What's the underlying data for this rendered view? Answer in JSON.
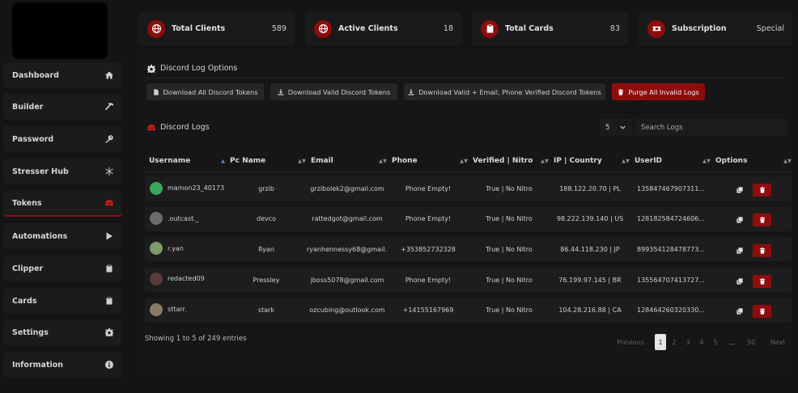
{
  "sidebar": {
    "items": [
      {
        "label": "Dashboard",
        "icon": "home-icon",
        "active": false
      },
      {
        "label": "Builder",
        "icon": "hammer-icon",
        "active": false
      },
      {
        "label": "Password",
        "icon": "key-icon",
        "active": false
      },
      {
        "label": "Stresser Hub",
        "icon": "snowflake-icon",
        "active": false
      },
      {
        "label": "Tokens",
        "icon": "discord-icon",
        "active": true
      },
      {
        "label": "Automations",
        "icon": "play-icon",
        "active": false
      },
      {
        "label": "Clipper",
        "icon": "clipboard-icon",
        "active": false
      },
      {
        "label": "Cards",
        "icon": "clipboard-icon",
        "active": false
      },
      {
        "label": "Settings",
        "icon": "gear-icon",
        "active": false
      },
      {
        "label": "Information",
        "icon": "info-icon",
        "active": false
      }
    ]
  },
  "stats": [
    {
      "label": "Total Clients",
      "value": "589",
      "icon": "globe-icon"
    },
    {
      "label": "Active Clients",
      "value": "18",
      "icon": "globe-icon"
    },
    {
      "label": "Total Cards",
      "value": "83",
      "icon": "clipboard-icon"
    },
    {
      "label": "Subscription",
      "value": "Special",
      "icon": "ticket-icon"
    }
  ],
  "options": {
    "title": "Discord Log Options",
    "buttons": {
      "download_all": "Download All Discord Tokens",
      "download_valid": "Download Valid Discord Tokens",
      "download_verified": "Download Valid + Email, Phone Verified Discord Tokens",
      "purge": "Purge All Invalid Logs"
    }
  },
  "logs": {
    "title": "Discord Logs",
    "page_size": "5",
    "search_placeholder": "Search Logs",
    "columns": [
      "Username",
      "Pc Name",
      "Email",
      "Phone",
      "Verified | Nitro",
      "IP | Country",
      "UserID",
      "Options"
    ],
    "rows": [
      {
        "username": "mamon23_40173",
        "pc": "grzib",
        "email": "grzibolek2@gmail.com",
        "phone": "Phone Empty!",
        "verified": "True | No Nitro",
        "ip": "188.122.20.70 | PL",
        "userid": "135847467907311..."
      },
      {
        "username": ".outcast._",
        "pc": "devco",
        "email": "rattedgot@gmail.com",
        "phone": "Phone Empty!",
        "verified": "True | No Nitro",
        "ip": "98.222.139.140 | US",
        "userid": "128182584724606..."
      },
      {
        "username": "r.yan",
        "pc": "Ryan",
        "email": "ryanhennessy68@gmail...",
        "phone": "+353852732328",
        "verified": "True | No Nitro",
        "ip": "86.44.118.230 | JP",
        "userid": "899354128478773..."
      },
      {
        "username": "redacted09",
        "pc": "Pressley",
        "email": "jboss5078@gmail.com",
        "phone": "Phone Empty!",
        "verified": "True | No Nitro",
        "ip": "76.199.97.145 | BR",
        "userid": "135564707413727..."
      },
      {
        "username": "sttarr.",
        "pc": "stark",
        "email": "ozcubing@outlook.com",
        "phone": "+14155167969",
        "verified": "True | No Nitro",
        "ip": "104.28.216.88 | CA",
        "userid": "128464260320330..."
      }
    ],
    "footer": "Showing 1 to 5 of 249 entries",
    "pagination": {
      "previous": "Previous",
      "pages": [
        "1",
        "2",
        "3",
        "4",
        "5",
        "...",
        "50"
      ],
      "next": "Next"
    }
  },
  "colors": {
    "accent": "#8f0c0c",
    "background": "#141414",
    "panel": "#1a1a1a"
  }
}
